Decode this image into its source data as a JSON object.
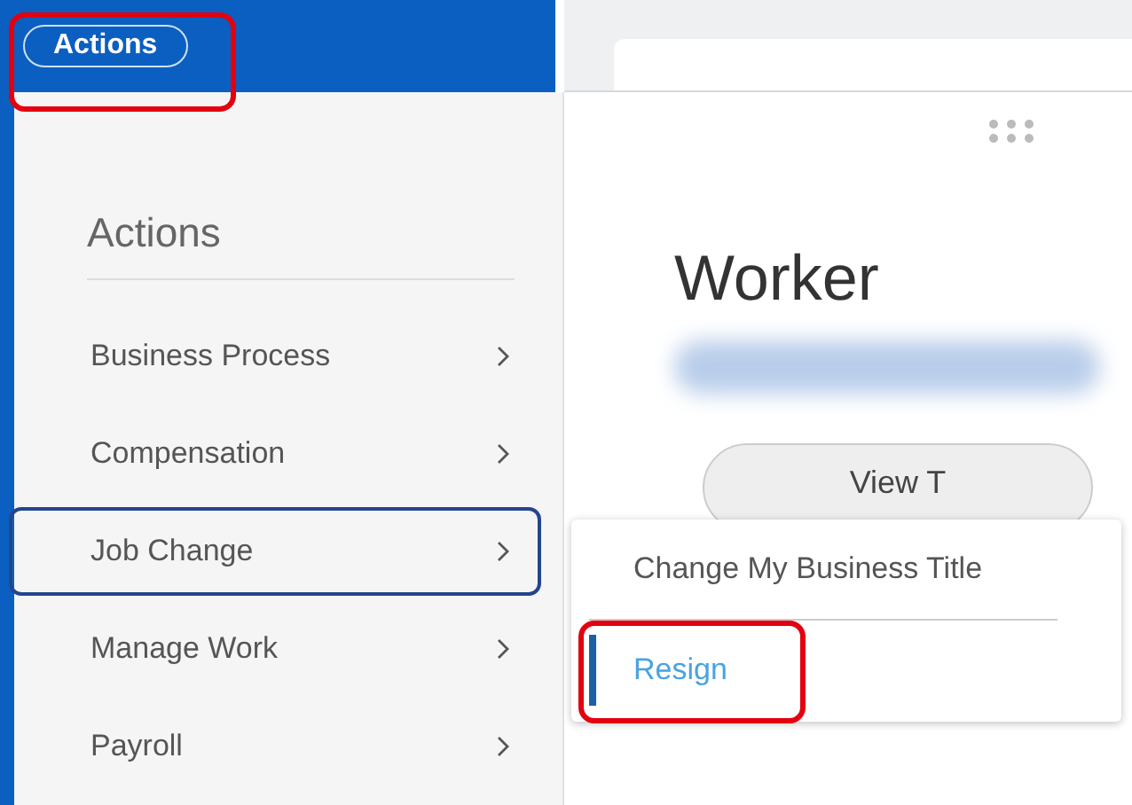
{
  "top_bar": {
    "actions_button": "Actions"
  },
  "actions_menu": {
    "title": "Actions",
    "items": [
      {
        "label": "Business Process",
        "selected": false
      },
      {
        "label": "Compensation",
        "selected": false
      },
      {
        "label": "Job Change",
        "selected": true
      },
      {
        "label": "Manage Work",
        "selected": false
      },
      {
        "label": "Payroll",
        "selected": false
      }
    ]
  },
  "worker_card": {
    "title": "Worker",
    "button": "View T"
  },
  "submenu": {
    "items": [
      {
        "label": "Change My Business Title",
        "selected": false
      },
      {
        "label": "Resign",
        "selected": true
      }
    ]
  }
}
